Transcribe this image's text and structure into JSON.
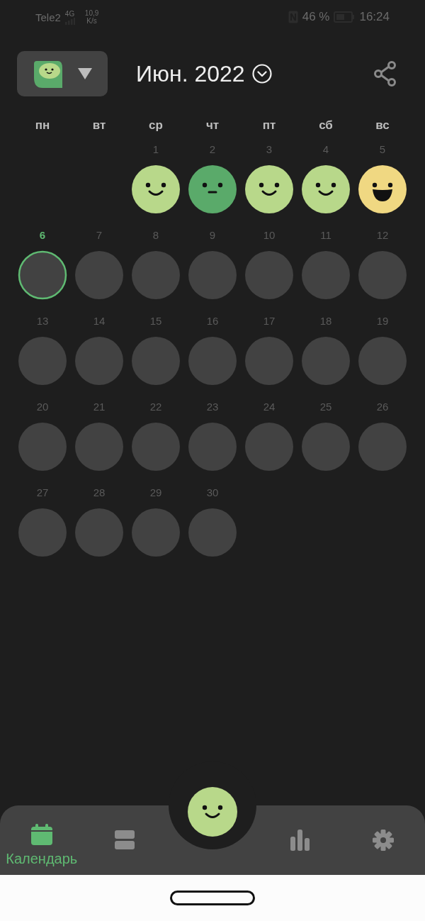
{
  "status_bar": {
    "carrier": "Tele2",
    "network": "4G",
    "speed": "10,9",
    "speed_unit": "K/s",
    "battery": "46 %",
    "time": "16:24"
  },
  "header": {
    "title": "Июн. 2022"
  },
  "weekdays": [
    "пн",
    "вт",
    "ср",
    "чт",
    "пт",
    "сб",
    "вс"
  ],
  "weeks": [
    [
      {
        "kind": "blank"
      },
      {
        "kind": "blank"
      },
      {
        "kind": "good",
        "day": "1",
        "today": false
      },
      {
        "kind": "neutral",
        "day": "2",
        "today": false
      },
      {
        "kind": "good",
        "day": "3",
        "today": false
      },
      {
        "kind": "good",
        "day": "4",
        "today": false
      },
      {
        "kind": "great",
        "day": "5",
        "today": false
      }
    ],
    [
      {
        "kind": "day",
        "day": "6",
        "today": true
      },
      {
        "kind": "day",
        "day": "7",
        "today": false
      },
      {
        "kind": "day",
        "day": "8",
        "today": false
      },
      {
        "kind": "day",
        "day": "9",
        "today": false
      },
      {
        "kind": "day",
        "day": "10",
        "today": false
      },
      {
        "kind": "day",
        "day": "11",
        "today": false
      },
      {
        "kind": "day",
        "day": "12",
        "today": false
      }
    ],
    [
      {
        "kind": "day",
        "day": "13",
        "today": false
      },
      {
        "kind": "day",
        "day": "14",
        "today": false
      },
      {
        "kind": "day",
        "day": "15",
        "today": false
      },
      {
        "kind": "day",
        "day": "16",
        "today": false
      },
      {
        "kind": "day",
        "day": "17",
        "today": false
      },
      {
        "kind": "day",
        "day": "18",
        "today": false
      },
      {
        "kind": "day",
        "day": "19",
        "today": false
      }
    ],
    [
      {
        "kind": "day",
        "day": "20",
        "today": false
      },
      {
        "kind": "day",
        "day": "21",
        "today": false
      },
      {
        "kind": "day",
        "day": "22",
        "today": false
      },
      {
        "kind": "day",
        "day": "23",
        "today": false
      },
      {
        "kind": "day",
        "day": "24",
        "today": false
      },
      {
        "kind": "day",
        "day": "25",
        "today": false
      },
      {
        "kind": "day",
        "day": "26",
        "today": false
      }
    ],
    [
      {
        "kind": "day",
        "day": "27",
        "today": false
      },
      {
        "kind": "day",
        "day": "28",
        "today": false
      },
      {
        "kind": "day",
        "day": "29",
        "today": false
      },
      {
        "kind": "day",
        "day": "30",
        "today": false
      }
    ]
  ],
  "add_mood": {
    "kind": "good"
  },
  "nav": [
    {
      "kind": "calendar",
      "label": "Календарь",
      "selected": true
    },
    {
      "kind": "entries",
      "selected": false
    },
    {
      "kind": "stats",
      "selected": false
    },
    {
      "kind": "settings",
      "selected": false
    }
  ]
}
